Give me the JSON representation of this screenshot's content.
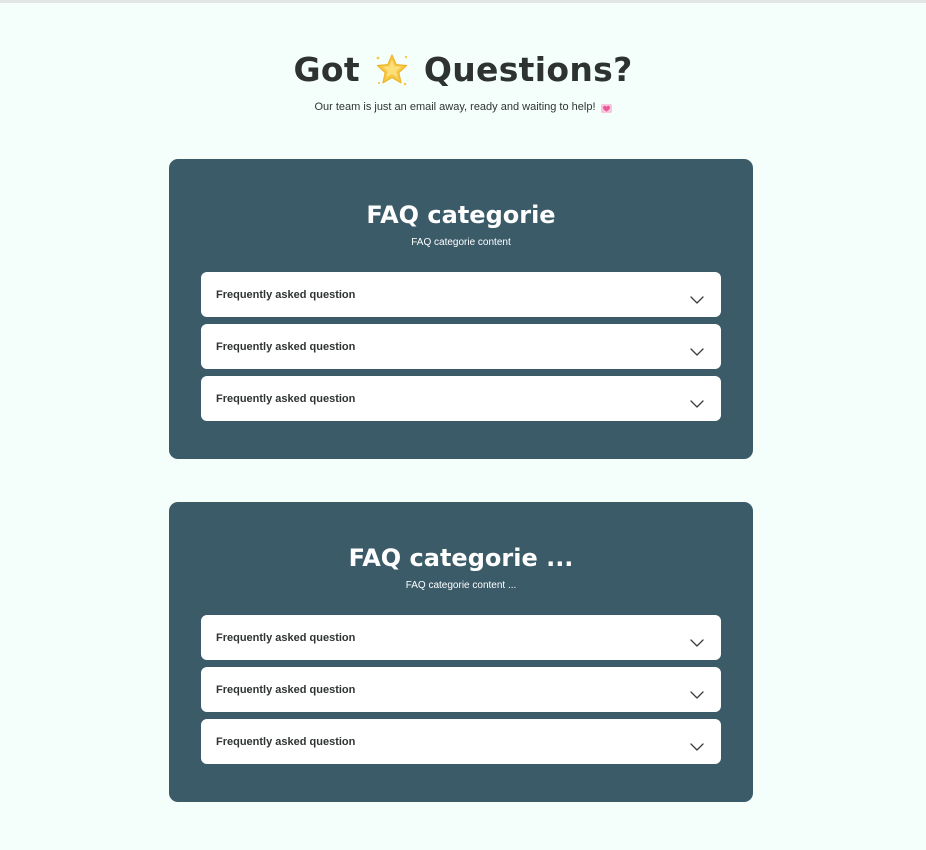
{
  "hero": {
    "title_before": "Got",
    "title_icon": "star-icon",
    "title_after": "Questions?",
    "subtitle": "Our team is just an email away, ready and waiting to help!",
    "subtitle_icon": "heart-icon"
  },
  "colors": {
    "background": "#f4fffb",
    "card": "#3b5b69",
    "item": "#ffffff",
    "text": "#2f3433",
    "star": "#f7c948",
    "heart": "#e85a9a"
  },
  "categories": [
    {
      "title": "FAQ categorie",
      "content": "FAQ categorie content",
      "items": [
        {
          "question": "Frequently asked question",
          "icon": "chevron-down-icon"
        },
        {
          "question": "Frequently asked question",
          "icon": "chevron-down-icon"
        },
        {
          "question": "Frequently asked question",
          "icon": "chevron-down-icon"
        }
      ]
    },
    {
      "title": "FAQ categorie ...",
      "content": "FAQ categorie content ...",
      "items": [
        {
          "question": "Frequently asked question",
          "icon": "chevron-down-icon"
        },
        {
          "question": "Frequently asked question",
          "icon": "chevron-down-icon"
        },
        {
          "question": "Frequently asked question",
          "icon": "chevron-down-icon"
        }
      ]
    }
  ]
}
